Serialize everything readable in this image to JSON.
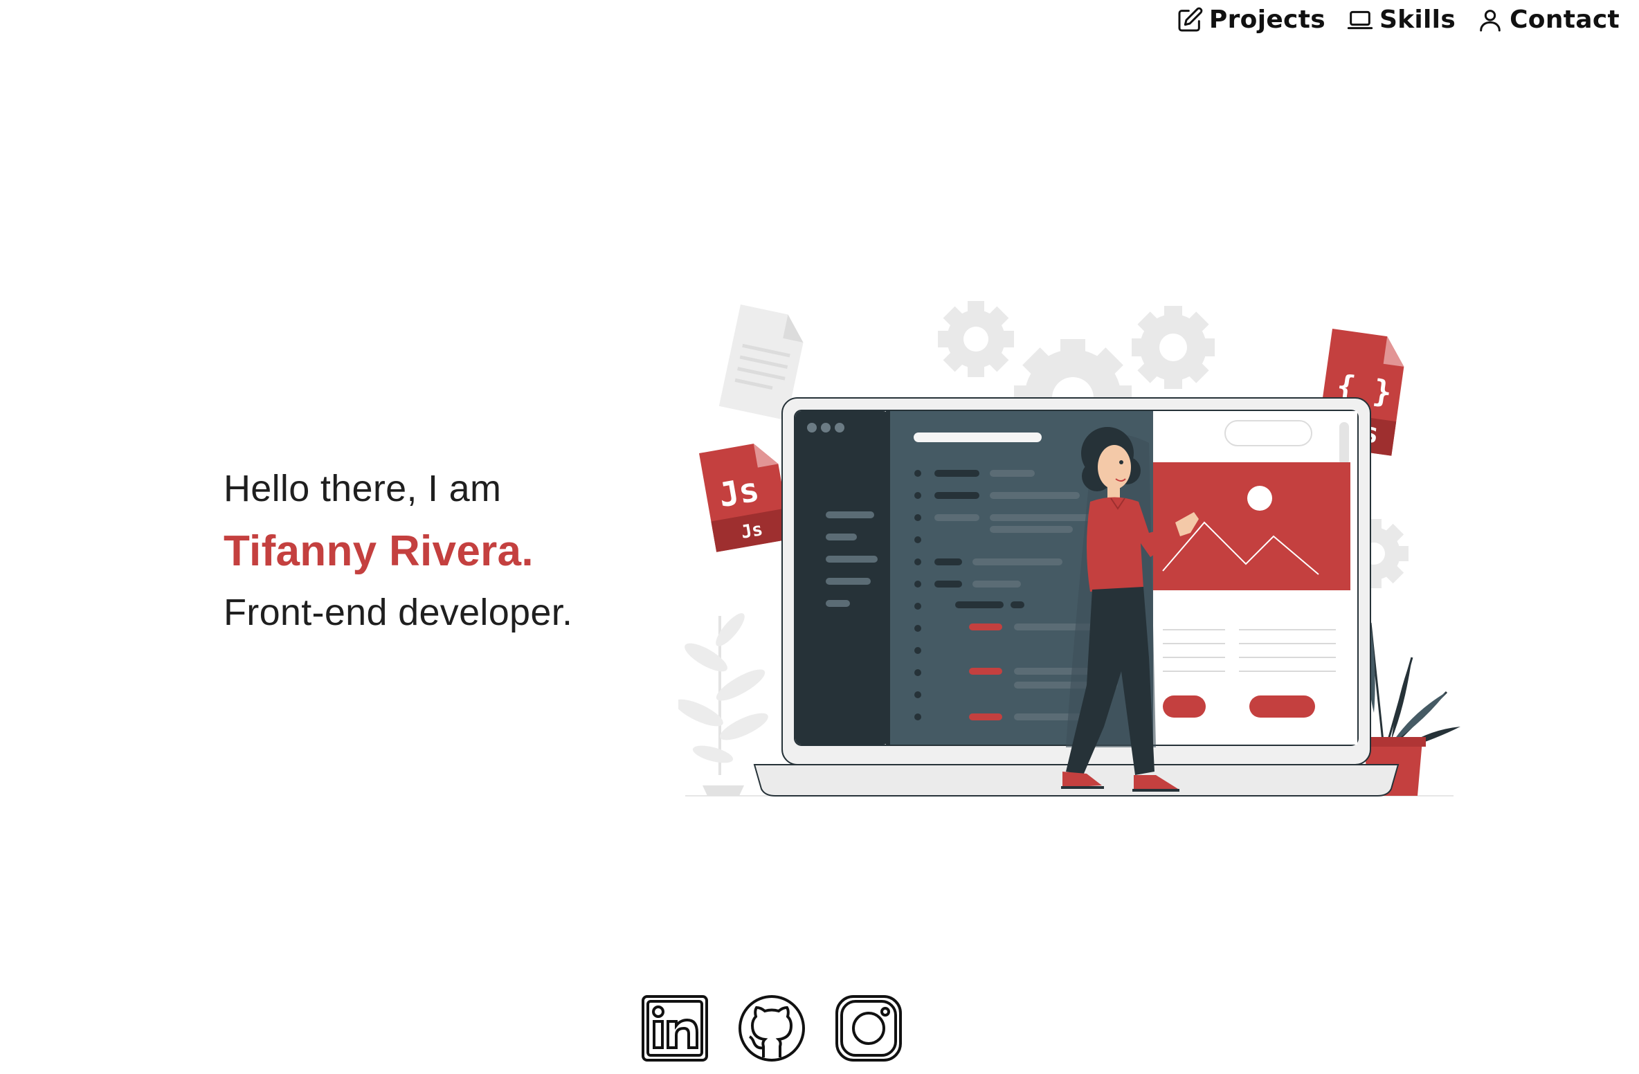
{
  "nav": {
    "items": [
      {
        "label": "Projects",
        "icon": "edit-icon"
      },
      {
        "label": "Skills",
        "icon": "laptop-icon"
      },
      {
        "label": "Contact",
        "icon": "user-icon"
      }
    ]
  },
  "hero": {
    "greeting": "Hello there, I am",
    "name": "Tifanny Rivera.",
    "role": "Front-end developer."
  },
  "illustration": {
    "js_file_label": "Js",
    "js_file_label_small": "Js",
    "css_file_label": "{ }",
    "css_file_label_small": "CSS"
  },
  "socials": [
    {
      "icon": "linkedin-icon"
    },
    {
      "icon": "github-icon"
    },
    {
      "icon": "instagram-icon"
    }
  ],
  "colors": {
    "accent": "#c4403f",
    "dark": "#263238",
    "editor": "#455a64"
  }
}
